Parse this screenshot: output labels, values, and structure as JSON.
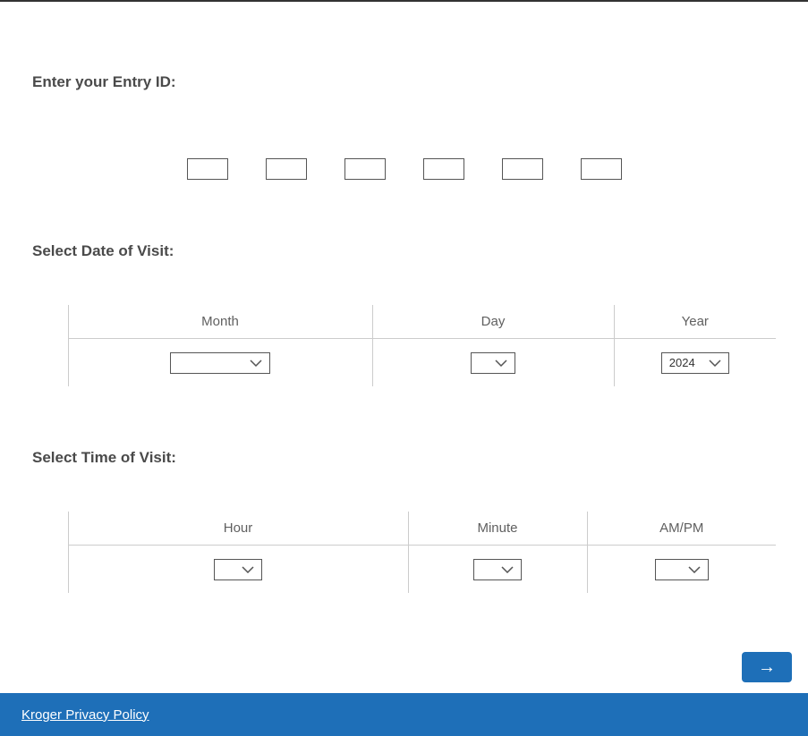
{
  "labels": {
    "entry_id": "Enter your Entry ID:",
    "date_of_visit": "Select Date of Visit:",
    "time_of_visit": "Select Time of Visit:"
  },
  "entry_id": {
    "fields": [
      "",
      "",
      "",
      "",
      "",
      ""
    ]
  },
  "date": {
    "headers": {
      "month": "Month",
      "day": "Day",
      "year": "Year"
    },
    "values": {
      "month": "",
      "day": "",
      "year": "2024"
    }
  },
  "time": {
    "headers": {
      "hour": "Hour",
      "minute": "Minute",
      "ampm": "AM/PM"
    },
    "values": {
      "hour": "",
      "minute": "",
      "ampm": ""
    }
  },
  "next_button": "→",
  "footer": {
    "privacy_link": "Kroger Privacy Policy"
  }
}
